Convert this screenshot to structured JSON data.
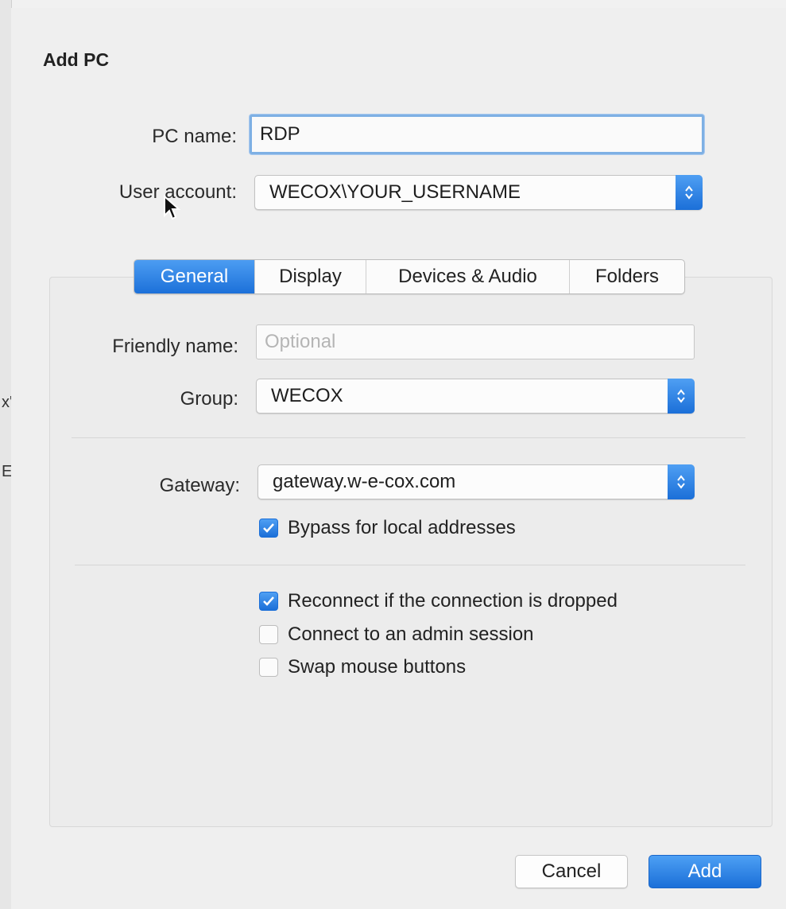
{
  "dialog": {
    "title": "Add PC"
  },
  "pc_name": {
    "label": "PC name:",
    "value": "RDP"
  },
  "user_account": {
    "label": "User account:",
    "value": "WECOX\\YOUR_USERNAME"
  },
  "tabs": [
    {
      "label": "General",
      "active": true
    },
    {
      "label": "Display",
      "active": false
    },
    {
      "label": "Devices & Audio",
      "active": false
    },
    {
      "label": "Folders",
      "active": false
    }
  ],
  "general": {
    "friendly_name": {
      "label": "Friendly name:",
      "value": "",
      "placeholder": "Optional"
    },
    "group": {
      "label": "Group:",
      "value": "WECOX"
    },
    "gateway": {
      "label": "Gateway:",
      "value": "gateway.w-e-cox.com"
    },
    "bypass_local": {
      "label": "Bypass for local addresses",
      "checked": true
    },
    "reconnect": {
      "label": "Reconnect if the connection is dropped",
      "checked": true
    },
    "admin_session": {
      "label": "Connect to an admin session",
      "checked": false
    },
    "swap_mouse": {
      "label": "Swap mouse buttons",
      "checked": false
    }
  },
  "footer": {
    "cancel_label": "Cancel",
    "add_label": "Add"
  },
  "background_window": {
    "fragments": [
      "x'",
      "E"
    ]
  },
  "colors": {
    "accent": "#1c70d9",
    "focus_ring": "#7eb0e4",
    "sheet_bg": "#efefef"
  }
}
